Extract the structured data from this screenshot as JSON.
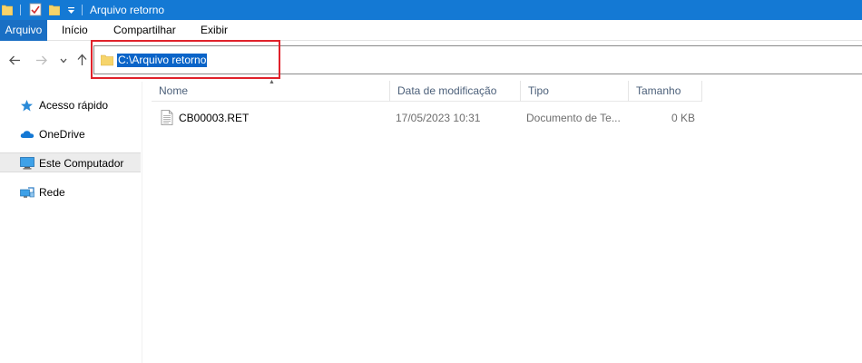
{
  "window": {
    "title": "Arquivo retorno"
  },
  "ribbon": {
    "tabs": [
      {
        "label": "Arquivo"
      },
      {
        "label": "Início"
      },
      {
        "label": "Compartilhar"
      },
      {
        "label": "Exibir"
      }
    ]
  },
  "address": {
    "path": "C:\\Arquivo retorno"
  },
  "sidebar": {
    "items": [
      {
        "label": "Acesso rápido",
        "icon": "star-icon"
      },
      {
        "label": "OneDrive",
        "icon": "cloud-icon"
      },
      {
        "label": "Este Computador",
        "icon": "computer-icon",
        "selected": true
      },
      {
        "label": "Rede",
        "icon": "network-icon"
      }
    ]
  },
  "file_list": {
    "columns": [
      "Nome",
      "Data de modificação",
      "Tipo",
      "Tamanho"
    ],
    "rows": [
      {
        "name": "CB00003.RET",
        "modified": "17/05/2023 10:31",
        "type": "Documento de Te...",
        "size": "0 KB"
      }
    ]
  },
  "colors": {
    "titlebar": "#1479d4",
    "accent": "#1a6fc4",
    "highlight_border": "#e0222b",
    "selection": "#0a64c8"
  }
}
